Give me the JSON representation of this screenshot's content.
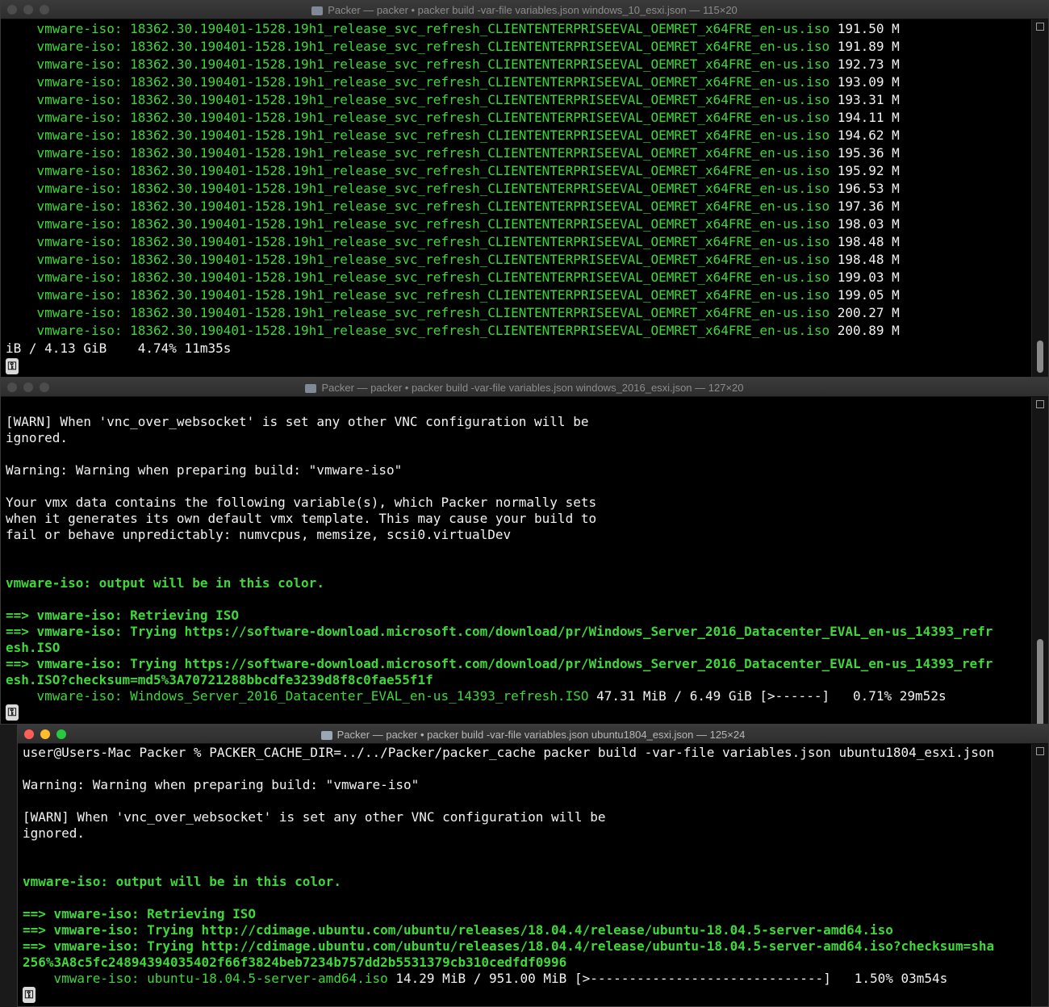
{
  "windows": [
    {
      "title": "Packer — packer • packer build -var-file variables.json windows_10_esxi.json — 115×20",
      "prefix": "vmware-iso: ",
      "filename": "18362.30.190401-1528.19h1_release_svc_refresh_CLIENTENTERPRISEEVAL_OEMRET_x64FRE_en-us.iso",
      "sizes": [
        "191.50 M",
        "191.89 M",
        "192.73 M",
        "193.09 M",
        "193.31 M",
        "194.11 M",
        "194.62 M",
        "195.36 M",
        "195.92 M",
        "196.53 M",
        "197.36 M",
        "198.03 M",
        "198.48 M",
        "198.48 M",
        "199.03 M",
        "199.05 M",
        "200.27 M",
        "200.89 M"
      ],
      "status_line": "iB / 4.13 GiB    4.74% 11m35s"
    },
    {
      "title": "Packer — packer • packer build -var-file variables.json windows_2016_esxi.json — 127×20",
      "lines": [
        "[WARN] When 'vnc_over_websocket' is set any other VNC configuration will be",
        "ignored.",
        "",
        "Warning: Warning when preparing build: \"vmware-iso\"",
        "",
        "Your vmx data contains the following variable(s), which Packer normally sets",
        "when it generates its own default vmx template. This may cause your build to",
        "fail or behave unpredictably: numvcpus, memsize, scsi0.virtualDev",
        "",
        "",
        "vmware-iso: output will be in this color.",
        "",
        "==> vmware-iso: Retrieving ISO",
        "==> vmware-iso: Trying https://software-download.microsoft.com/download/pr/Windows_Server_2016_Datacenter_EVAL_en-us_14393_refr",
        "esh.ISO",
        "==> vmware-iso: Trying https://software-download.microsoft.com/download/pr/Windows_Server_2016_Datacenter_EVAL_en-us_14393_refr",
        "esh.ISO?checksum=md5%3A70721288bbcdfe3239d8f8c0fae55f1f",
        "    vmware-iso: Windows_Server_2016_Datacenter_EVAL_en-us_14393_refresh.ISO"
      ],
      "progress": " 47.31 MiB / 6.49 GiB [>------]   0.71% 29m52s"
    },
    {
      "title": "Packer — packer • packer build -var-file variables.json ubuntu1804_esxi.json — 125×24",
      "lines": [
        "user@Users-Mac Packer % PACKER_CACHE_DIR=../../Packer/packer_cache packer build -var-file variables.json ubuntu1804_esxi.json",
        "",
        "Warning: Warning when preparing build: \"vmware-iso\"",
        "",
        "[WARN] When 'vnc_over_websocket' is set any other VNC configuration will be",
        "ignored.",
        "",
        "",
        "vmware-iso: output will be in this color.",
        "",
        "==> vmware-iso: Retrieving ISO",
        "==> vmware-iso: Trying http://cdimage.ubuntu.com/ubuntu/releases/18.04.4/release/ubuntu-18.04.5-server-amd64.iso",
        "==> vmware-iso: Trying http://cdimage.ubuntu.com/ubuntu/releases/18.04.4/release/ubuntu-18.04.5-server-amd64.iso?checksum=sha",
        "256%3A8c5fc24894394035402f66f3824beb7234b757dd2b5531379cb310cedfdf0996",
        "    vmware-iso: ubuntu-18.04.5-server-amd64.iso"
      ],
      "progress": " 14.29 MiB / 951.00 MiB [>------------------------------]   1.50% 03m54s"
    }
  ],
  "key_icon_glyph": "⚿",
  "colors": {
    "green": "#3fd83a",
    "text": "#f2f2f2",
    "background": "#000000"
  }
}
